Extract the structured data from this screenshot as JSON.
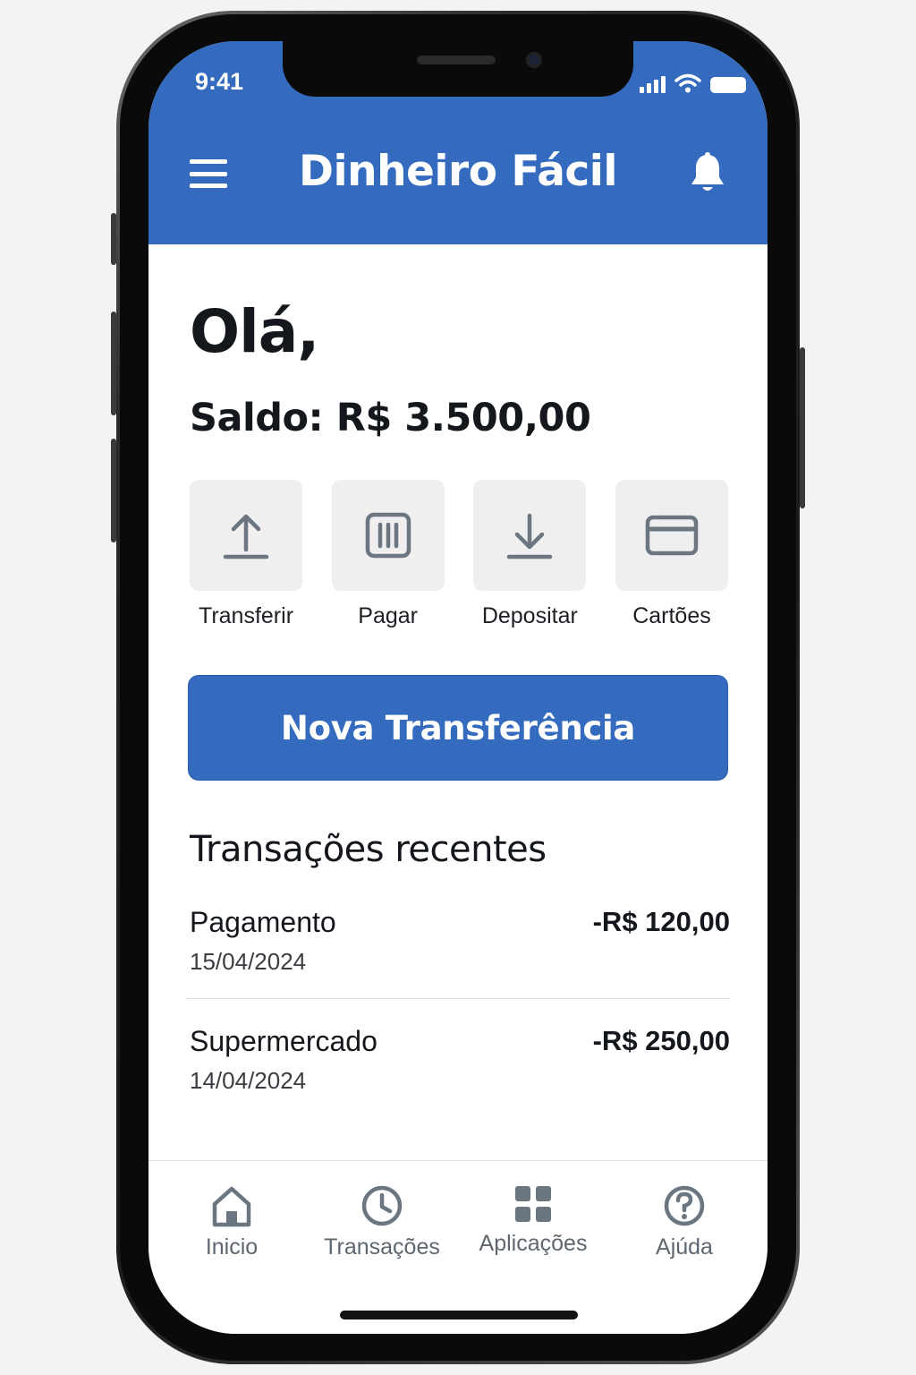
{
  "status_bar": {
    "time": "9:41"
  },
  "header": {
    "title": "Dinheiro Fácil"
  },
  "greeting": "Olá,",
  "balance": "Saldo: R$ 3.500,00",
  "quick_actions": [
    {
      "label": "Transferir",
      "icon": "upload-arrow-icon"
    },
    {
      "label": "Pagar",
      "icon": "barcode-icon"
    },
    {
      "label": "Depositar",
      "icon": "download-arrow-icon"
    },
    {
      "label": "Cartões",
      "icon": "credit-card-icon"
    }
  ],
  "primary_button": "Nova Transferência",
  "recent": {
    "title": "Transações recentes",
    "items": [
      {
        "name": "Pagamento",
        "date": "15/04/2024",
        "amount": "-R$ 120,00"
      },
      {
        "name": "Supermercado",
        "date": "14/04/2024",
        "amount": "-R$ 250,00"
      }
    ]
  },
  "bottom_nav": [
    {
      "label": "Inicio",
      "icon": "home-icon"
    },
    {
      "label": "Transações",
      "icon": "clock-icon"
    },
    {
      "label": "Aplicações",
      "icon": "grid-icon"
    },
    {
      "label": "Ajúda",
      "icon": "help-icon"
    }
  ],
  "colors": {
    "brand": "#346bbf",
    "tile_bg": "#efefef",
    "icon_gray": "#6b7680",
    "text_dark": "#14171c"
  }
}
